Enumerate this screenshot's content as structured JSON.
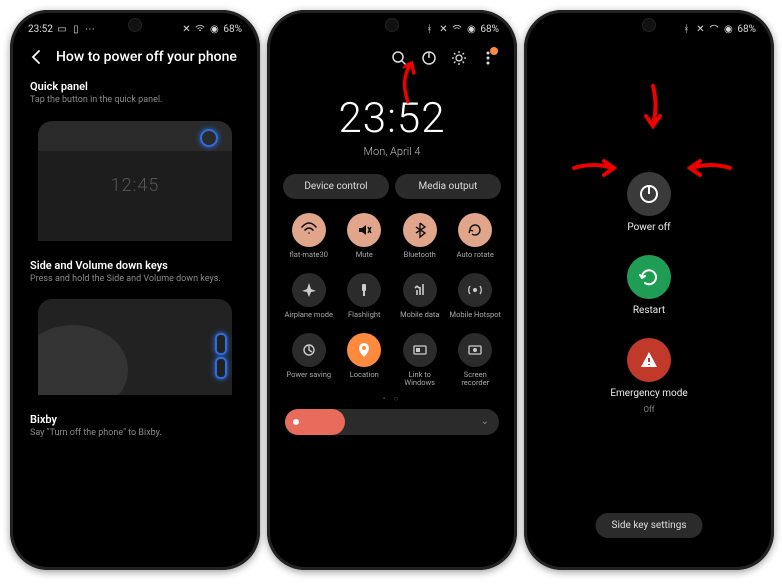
{
  "status": {
    "time": "23:52",
    "battery": "68%",
    "vibrate_icon": true
  },
  "p1": {
    "title": "How to power off your phone",
    "sections": [
      {
        "heading": "Quick panel",
        "body": "Tap the button in the quick panel.",
        "mock_clock": "12:45"
      },
      {
        "heading": "Side and Volume down keys",
        "body": "Press and hold the Side and Volume down keys."
      },
      {
        "heading": "Bixby",
        "body": "Say \"Turn off the phone\" to Bixby."
      }
    ]
  },
  "p2": {
    "clock": {
      "time": "23:52",
      "date": "Mon, April 4"
    },
    "pills": [
      "Device control",
      "Media output"
    ],
    "tiles": [
      {
        "label": "flat-mate30",
        "on": true,
        "icon": "wifi"
      },
      {
        "label": "Mute",
        "on": true,
        "icon": "mute"
      },
      {
        "label": "Bluetooth",
        "on": true,
        "icon": "bt"
      },
      {
        "label": "Auto rotate",
        "on": true,
        "icon": "rotate"
      },
      {
        "label": "Airplane mode",
        "on": false,
        "icon": "plane"
      },
      {
        "label": "Flashlight",
        "on": false,
        "icon": "flash"
      },
      {
        "label": "Mobile data",
        "on": false,
        "icon": "mdata"
      },
      {
        "label": "Mobile Hotspot",
        "on": false,
        "icon": "hotspot"
      },
      {
        "label": "Power saving",
        "on": false,
        "icon": "leaf"
      },
      {
        "label": "Location",
        "on": false,
        "icon": "pin",
        "loc": true
      },
      {
        "label": "Link to Windows",
        "on": false,
        "icon": "link"
      },
      {
        "label": "Screen recorder",
        "on": false,
        "icon": "rec"
      }
    ]
  },
  "p3": {
    "items": [
      {
        "label": "Power off",
        "color": "#3a3a3a",
        "icon": "power"
      },
      {
        "label": "Restart",
        "color": "#1f9d55",
        "icon": "restart"
      },
      {
        "label": "Emergency mode",
        "sub": "Off",
        "color": "#c0392b",
        "icon": "alert"
      }
    ],
    "footer": "Side key settings"
  }
}
